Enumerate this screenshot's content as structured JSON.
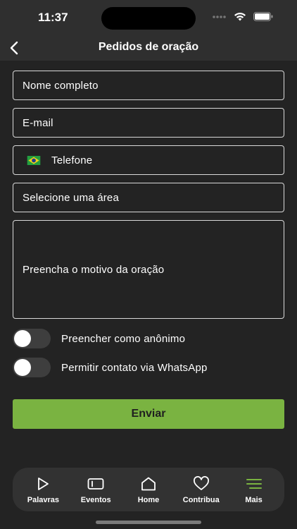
{
  "status": {
    "time": "11:37"
  },
  "header": {
    "title": "Pedidos de oração"
  },
  "form": {
    "name_placeholder": "Nome completo",
    "email_placeholder": "E-mail",
    "phone_placeholder": "Telefone",
    "area_placeholder": "Selecione uma área",
    "reason_placeholder": "Preencha o motivo da oração",
    "anonymous_label": "Preencher como anônimo",
    "anonymous_on": false,
    "whatsapp_label": "Permitir contato via WhatsApp",
    "whatsapp_on": false,
    "submit_label": "Enviar"
  },
  "tabbar": {
    "items": [
      {
        "label": "Palavras",
        "icon": "play-icon",
        "active": false
      },
      {
        "label": "Eventos",
        "icon": "ticket-icon",
        "active": false
      },
      {
        "label": "Home",
        "icon": "home-icon",
        "active": false
      },
      {
        "label": "Contribua",
        "icon": "heart-icon",
        "active": false
      },
      {
        "label": "Mais",
        "icon": "menu-icon",
        "active": true
      }
    ]
  },
  "colors": {
    "accent": "#7ab341",
    "background": "#232323",
    "bar": "#2f2f2f"
  }
}
